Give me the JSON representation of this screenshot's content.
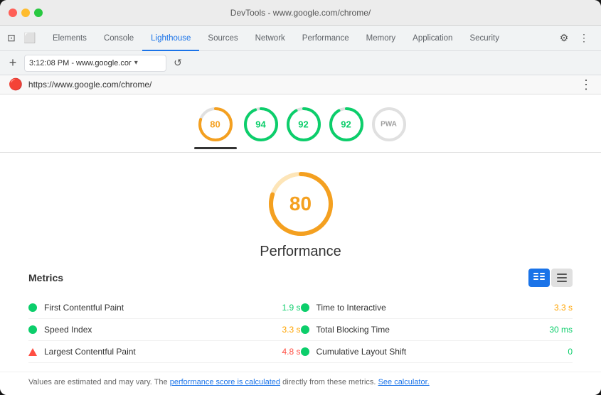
{
  "titleBar": {
    "title": "DevTools - www.google.com/chrome/"
  },
  "tabs": [
    {
      "id": "elements",
      "label": "Elements",
      "active": false
    },
    {
      "id": "console",
      "label": "Console",
      "active": false
    },
    {
      "id": "lighthouse",
      "label": "Lighthouse",
      "active": true
    },
    {
      "id": "sources",
      "label": "Sources",
      "active": false
    },
    {
      "id": "network",
      "label": "Network",
      "active": false
    },
    {
      "id": "performance",
      "label": "Performance",
      "active": false
    },
    {
      "id": "memory",
      "label": "Memory",
      "active": false
    },
    {
      "id": "application",
      "label": "Application",
      "active": false
    },
    {
      "id": "security",
      "label": "Security",
      "active": false
    }
  ],
  "addressBar": {
    "value": "3:12:08 PM - www.google.cor",
    "dropdown": "▾"
  },
  "lighthouseUrl": "https://www.google.com/chrome/",
  "scoreCircles": [
    {
      "id": "perf",
      "score": 80,
      "color": "#f4a020",
      "trackColor": "#fde5b8",
      "selected": true
    },
    {
      "id": "access",
      "score": 94,
      "color": "#0cce6b",
      "trackColor": "#c0f0d8",
      "selected": false
    },
    {
      "id": "best",
      "score": 92,
      "color": "#0cce6b",
      "trackColor": "#c0f0d8",
      "selected": false
    },
    {
      "id": "seo",
      "score": 92,
      "color": "#0cce6b",
      "trackColor": "#c0f0d8",
      "selected": false
    },
    {
      "id": "pwa",
      "score": null,
      "label": "PWA",
      "color": "#9e9e9e",
      "trackColor": "#e0e0e0",
      "selected": false
    }
  ],
  "mainScore": {
    "value": 80,
    "title": "Performance",
    "color": "#f4a020",
    "trackColor": "#fde5b8"
  },
  "metrics": {
    "title": "Metrics",
    "viewButtons": [
      {
        "id": "grid-view",
        "icon": "≡≡",
        "active": true
      },
      {
        "id": "list-view",
        "icon": "☰",
        "active": false
      }
    ],
    "items": [
      {
        "name": "First Contentful Paint",
        "value": "1.9 s",
        "valueColor": "green",
        "indicator": "dot-green",
        "col": 0
      },
      {
        "name": "Time to Interactive",
        "value": "3.3 s",
        "valueColor": "orange",
        "indicator": "dot-green",
        "col": 1
      },
      {
        "name": "Speed Index",
        "value": "3.3 s",
        "valueColor": "orange",
        "indicator": "dot-green",
        "col": 0
      },
      {
        "name": "Total Blocking Time",
        "value": "30 ms",
        "valueColor": "green",
        "indicator": "dot-green",
        "col": 1
      },
      {
        "name": "Largest Contentful Paint",
        "value": "4.8 s",
        "valueColor": "red",
        "indicator": "triangle-red",
        "col": 0
      },
      {
        "name": "Cumulative Layout Shift",
        "value": "0",
        "valueColor": "green",
        "indicator": "dot-green",
        "col": 1
      }
    ]
  },
  "footer": {
    "text": "Values are estimated and may vary. The ",
    "link1": "performance score is calculated",
    "mid": " directly from these metrics. ",
    "link2": "See calculator.",
    "end": ""
  }
}
